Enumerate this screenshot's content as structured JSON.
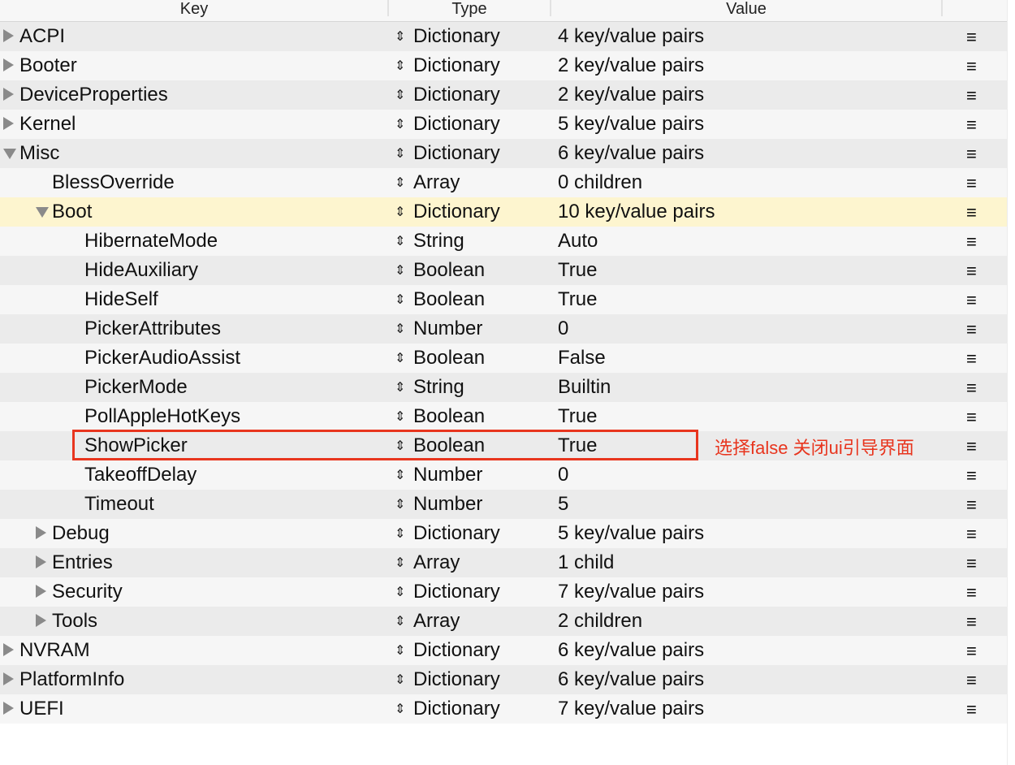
{
  "header": {
    "key": "Key",
    "type": "Type",
    "value": "Value"
  },
  "type_arrows": "⇕",
  "menu_icon": "≡",
  "rows": [
    {
      "key": "ACPI",
      "type": "Dictionary",
      "value": "4 key/value pairs",
      "level": 0,
      "disclosure": "collapsed"
    },
    {
      "key": "Booter",
      "type": "Dictionary",
      "value": "2 key/value pairs",
      "level": 0,
      "disclosure": "collapsed"
    },
    {
      "key": "DeviceProperties",
      "type": "Dictionary",
      "value": "2 key/value pairs",
      "level": 0,
      "disclosure": "collapsed"
    },
    {
      "key": "Kernel",
      "type": "Dictionary",
      "value": "5 key/value pairs",
      "level": 0,
      "disclosure": "collapsed"
    },
    {
      "key": "Misc",
      "type": "Dictionary",
      "value": "6 key/value pairs",
      "level": 0,
      "disclosure": "expanded"
    },
    {
      "key": "BlessOverride",
      "type": "Array",
      "value": "0 children",
      "level": 1,
      "disclosure": "none"
    },
    {
      "key": "Boot",
      "type": "Dictionary",
      "value": "10 key/value pairs",
      "level": 1,
      "disclosure": "expanded",
      "selected": true
    },
    {
      "key": "HibernateMode",
      "type": "String",
      "value": "Auto",
      "level": 2,
      "disclosure": "none"
    },
    {
      "key": "HideAuxiliary",
      "type": "Boolean",
      "value": "True",
      "level": 2,
      "disclosure": "none"
    },
    {
      "key": "HideSelf",
      "type": "Boolean",
      "value": "True",
      "level": 2,
      "disclosure": "none"
    },
    {
      "key": "PickerAttributes",
      "type": "Number",
      "value": "0",
      "level": 2,
      "disclosure": "none"
    },
    {
      "key": "PickerAudioAssist",
      "type": "Boolean",
      "value": "False",
      "level": 2,
      "disclosure": "none"
    },
    {
      "key": "PickerMode",
      "type": "String",
      "value": "Builtin",
      "level": 2,
      "disclosure": "none"
    },
    {
      "key": "PollAppleHotKeys",
      "type": "Boolean",
      "value": "True",
      "level": 2,
      "disclosure": "none"
    },
    {
      "key": "ShowPicker",
      "type": "Boolean",
      "value": "True",
      "level": 2,
      "disclosure": "none"
    },
    {
      "key": "TakeoffDelay",
      "type": "Number",
      "value": "0",
      "level": 2,
      "disclosure": "none"
    },
    {
      "key": "Timeout",
      "type": "Number",
      "value": "5",
      "level": 2,
      "disclosure": "none"
    },
    {
      "key": "Debug",
      "type": "Dictionary",
      "value": "5 key/value pairs",
      "level": 1,
      "disclosure": "collapsed"
    },
    {
      "key": "Entries",
      "type": "Array",
      "value": "1 child",
      "level": 1,
      "disclosure": "collapsed"
    },
    {
      "key": "Security",
      "type": "Dictionary",
      "value": "7 key/value pairs",
      "level": 1,
      "disclosure": "collapsed"
    },
    {
      "key": "Tools",
      "type": "Array",
      "value": "2 children",
      "level": 1,
      "disclosure": "collapsed"
    },
    {
      "key": "NVRAM",
      "type": "Dictionary",
      "value": "6 key/value pairs",
      "level": 0,
      "disclosure": "collapsed"
    },
    {
      "key": "PlatformInfo",
      "type": "Dictionary",
      "value": "6 key/value pairs",
      "level": 0,
      "disclosure": "collapsed"
    },
    {
      "key": "UEFI",
      "type": "Dictionary",
      "value": "7 key/value pairs",
      "level": 0,
      "disclosure": "collapsed"
    }
  ],
  "annotation": {
    "text": "选择false 关闭ui引导界面",
    "color": "#e8351e"
  },
  "colors": {
    "row_odd": "#ebebeb",
    "row_even": "#f6f6f6",
    "row_selected": "#fdf5cf",
    "annotation_red": "#e8351e"
  }
}
